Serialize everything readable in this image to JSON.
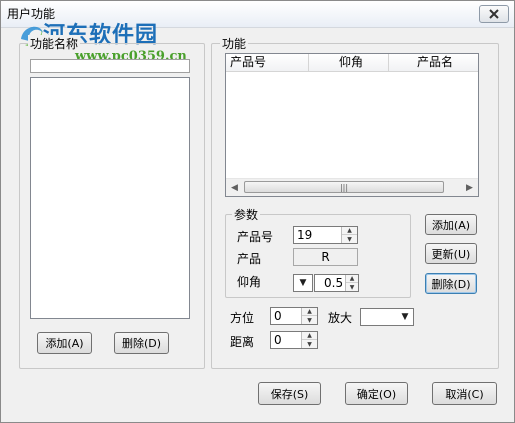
{
  "window": {
    "title": "用户功能"
  },
  "watermark": {
    "brand": "河东软件园",
    "url": "www.pc0359.cn"
  },
  "left_group": {
    "label": "功能名称",
    "add_button": "添加(A)",
    "delete_button": "删除(D)"
  },
  "right_group": {
    "label": "功能",
    "table": {
      "columns": [
        "产品号",
        "仰角",
        "产品名"
      ],
      "rows": []
    },
    "params": {
      "label": "参数",
      "product_no_label": "产品号",
      "product_no_value": "19",
      "product_label": "产品",
      "product_value": "R",
      "elevation_label": "仰角",
      "elevation_value": "0.5"
    },
    "add_button": "添加(A)",
    "update_button": "更新(U)",
    "delete_button": "删除(D)",
    "azimuth_label": "方位",
    "azimuth_value": "0",
    "zoom_label": "放大",
    "zoom_value": "",
    "distance_label": "距离",
    "distance_value": "0"
  },
  "footer": {
    "save_button": "保存(S)",
    "ok_button": "确定(O)",
    "cancel_button": "取消(C)"
  }
}
